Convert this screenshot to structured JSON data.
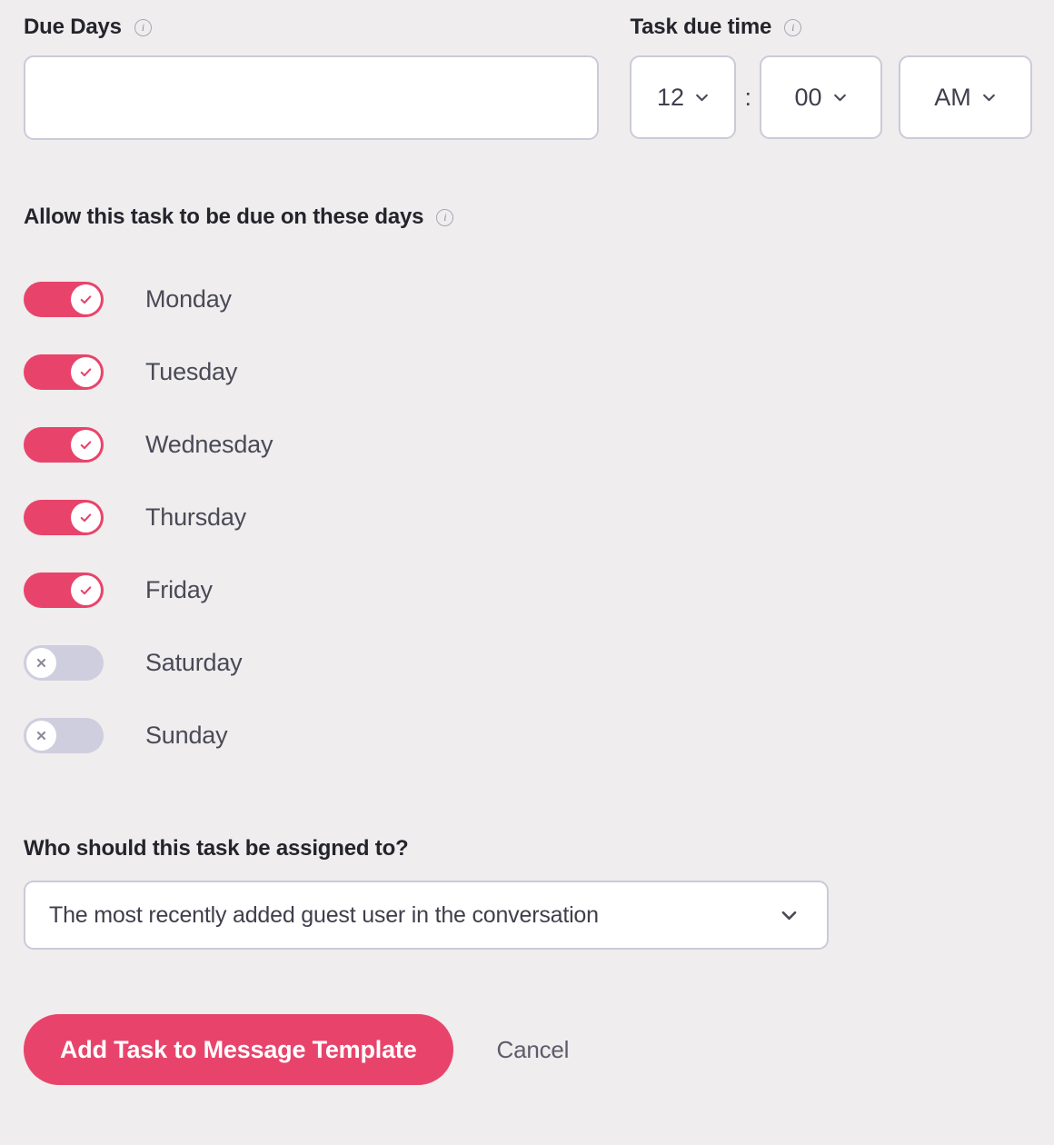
{
  "due_days": {
    "label": "Due Days",
    "info_icon": "info-icon",
    "value": "",
    "placeholder": ""
  },
  "task_due_time": {
    "label": "Task due time",
    "info_icon": "info-icon",
    "hour": "12",
    "separator": ":",
    "minute": "00",
    "meridiem": "AM",
    "chevron_icon": "chevron-down-icon"
  },
  "allowed_days": {
    "heading": "Allow this task to be due on these days",
    "info_icon": "info-icon",
    "days": [
      {
        "label": "Monday",
        "enabled": true,
        "icon": "check-icon"
      },
      {
        "label": "Tuesday",
        "enabled": true,
        "icon": "check-icon"
      },
      {
        "label": "Wednesday",
        "enabled": true,
        "icon": "check-icon"
      },
      {
        "label": "Thursday",
        "enabled": true,
        "icon": "check-icon"
      },
      {
        "label": "Friday",
        "enabled": true,
        "icon": "check-icon"
      },
      {
        "label": "Saturday",
        "enabled": false,
        "icon": "close-icon"
      },
      {
        "label": "Sunday",
        "enabled": false,
        "icon": "close-icon"
      }
    ]
  },
  "assignee": {
    "heading": "Who should this task be assigned to?",
    "selected": "The most recently added guest user in the conversation",
    "chevron_icon": "chevron-down-icon"
  },
  "actions": {
    "submit_label": "Add Task to Message Template",
    "cancel_label": "Cancel"
  },
  "colors": {
    "accent": "#e8446b",
    "background": "#efedee",
    "border": "#cbcad8",
    "toggle_off": "#cfcede",
    "heading_text": "#24242b",
    "body_text": "#4a4a57"
  }
}
